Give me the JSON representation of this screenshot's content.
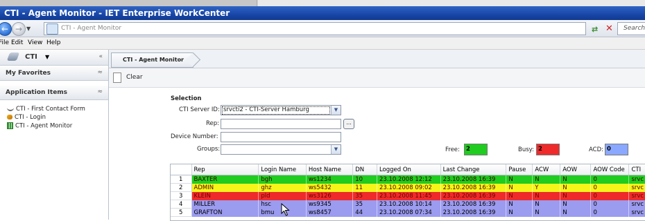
{
  "window": {
    "title": "CTI - Agent Monitor  -  IET Enterprise WorkCenter"
  },
  "address_bar": {
    "url_text": "CTI - Agent Monitor",
    "search_placeholder": "Search"
  },
  "menu": {
    "items": [
      "File",
      "Edit",
      "View",
      "Help"
    ]
  },
  "sidebar": {
    "module_title": "CTI",
    "collapse_glyph": "«",
    "sections": [
      {
        "title": "My Favorites",
        "toggle": "≈"
      },
      {
        "title": "Application Items",
        "toggle": "≈"
      }
    ],
    "items": [
      {
        "label": "CTI - First Contact Form",
        "icon": "phone-icon"
      },
      {
        "label": "CTI - Login",
        "icon": "key-icon"
      },
      {
        "label": "CTI - Agent Monitor",
        "icon": "grid-icon"
      }
    ]
  },
  "breadcrumb": {
    "label": "CTI - Agent Monitor"
  },
  "toolbar": {
    "clear_label": "Clear"
  },
  "selection": {
    "heading": "Selection",
    "server_label": "CTI Server ID:",
    "server_value": "srvcti2 - CTI-Server Hamburg",
    "rep_label": "Rep:",
    "rep_value": "",
    "browse_label": "...",
    "device_label": "Device Number:",
    "device_value": "",
    "groups_label": "Groups:",
    "groups_value": ""
  },
  "counters": {
    "free_label": "Free:",
    "free_value": "2",
    "free_color": "#1fcc1f",
    "busy_label": "Busy:",
    "busy_value": "2",
    "busy_color": "#ef2a2a",
    "acd_label": "ACD:",
    "acd_value": "0",
    "acd_color": "#8aa8ff"
  },
  "table": {
    "columns": [
      "Rep",
      "Login Name",
      "Host Name",
      "DN",
      "Logged On",
      "Last Change",
      "Pause",
      "ACW",
      "AOW",
      "AOW Code",
      "CTI"
    ],
    "rows": [
      {
        "n": "1",
        "status": "green",
        "cells": [
          "BAXTER",
          "bgh",
          "ws1234",
          "10",
          "23.10.2008 12:12",
          "23.10.2008 16:39",
          "N",
          "N",
          "N",
          "0",
          "srvc"
        ]
      },
      {
        "n": "2",
        "status": "yellow",
        "cells": [
          "ADMIN",
          "ghz",
          "ws5432",
          "11",
          "23.10.2008 09:02",
          "23.10.2008 16:39",
          "N",
          "Y",
          "N",
          "0",
          "srvc"
        ]
      },
      {
        "n": "3",
        "status": "red",
        "cells": [
          "KLEIN",
          "pld",
          "ws3126",
          "35",
          "23.10.2008 11:45",
          "23.10.2008 16:39",
          "N",
          "N",
          "N",
          "0",
          "srvc"
        ]
      },
      {
        "n": "4",
        "status": "blue",
        "cells": [
          "MILLER",
          "hsc",
          "ws9345",
          "35",
          "23.10.2008 10:14",
          "23.10.2008 16:39",
          "N",
          "N",
          "N",
          "0",
          "srvc"
        ]
      },
      {
        "n": "5",
        "status": "blue",
        "cells": [
          "GRAFTON",
          "bmu",
          "ws8457",
          "44",
          "23.10.2008 07:34",
          "23.10.2008 16:39",
          "N",
          "N",
          "N",
          "0",
          "srvc"
        ]
      }
    ]
  }
}
